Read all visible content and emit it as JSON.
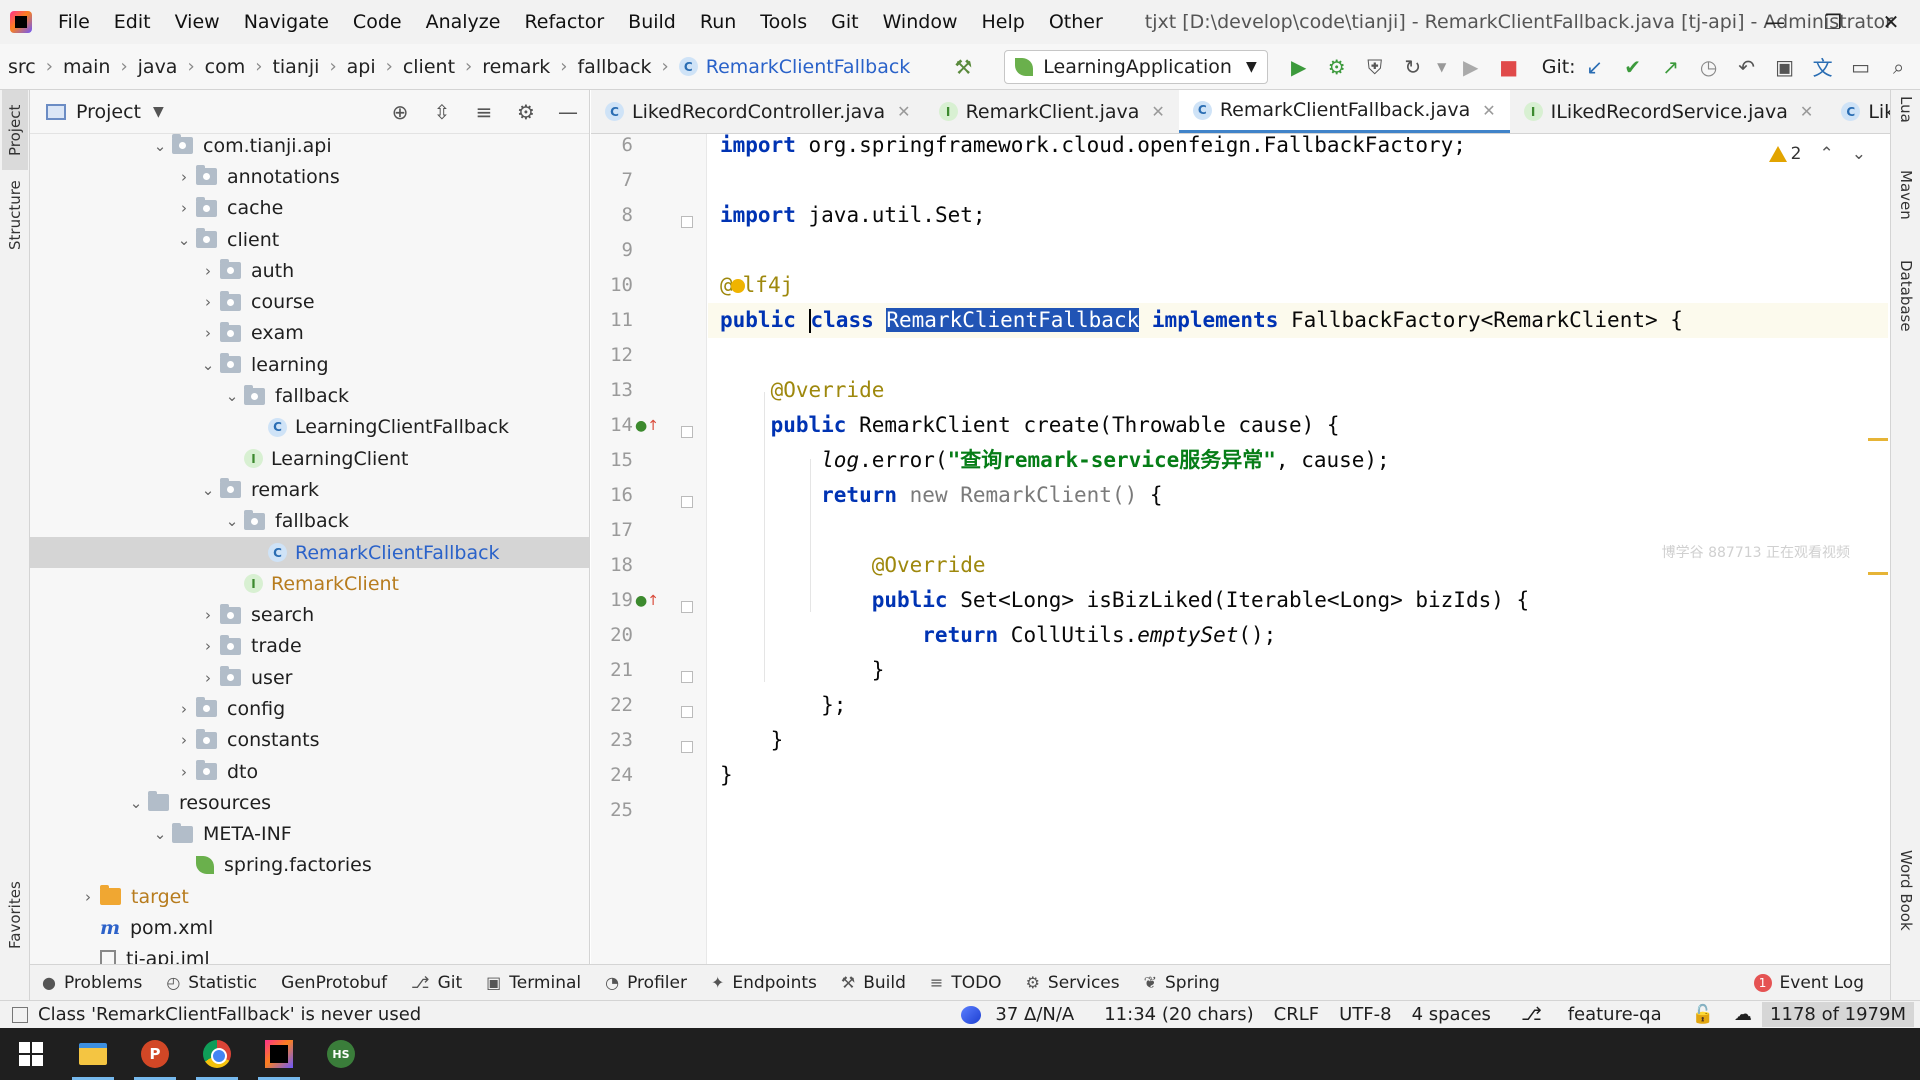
{
  "menubar": {
    "items": [
      "File",
      "Edit",
      "View",
      "Navigate",
      "Code",
      "Analyze",
      "Refactor",
      "Build",
      "Run",
      "Tools",
      "Git",
      "Window",
      "Help",
      "Other"
    ],
    "window_title": "tjxt [D:\\develop\\code\\tianji] - RemarkClientFallback.java [tj-api] - Administrator"
  },
  "breadcrumb": [
    "src",
    "main",
    "java",
    "com",
    "tianji",
    "api",
    "client",
    "remark",
    "fallback",
    "RemarkClientFallback"
  ],
  "run_config": "LearningApplication",
  "git_label": "Git:",
  "project_panel": {
    "title": "Project",
    "tree": [
      {
        "label": "com.tianji.api",
        "type": "package",
        "depth": 5,
        "state": "open"
      },
      {
        "label": "annotations",
        "type": "package",
        "depth": 6,
        "state": "closed"
      },
      {
        "label": "cache",
        "type": "package",
        "depth": 6,
        "state": "closed"
      },
      {
        "label": "client",
        "type": "package",
        "depth": 6,
        "state": "open"
      },
      {
        "label": "auth",
        "type": "package",
        "depth": 7,
        "state": "closed"
      },
      {
        "label": "course",
        "type": "package",
        "depth": 7,
        "state": "closed"
      },
      {
        "label": "exam",
        "type": "package",
        "depth": 7,
        "state": "closed"
      },
      {
        "label": "learning",
        "type": "package",
        "depth": 7,
        "state": "open"
      },
      {
        "label": "fallback",
        "type": "package",
        "depth": 8,
        "state": "open"
      },
      {
        "label": "LearningClientFallback",
        "type": "class",
        "depth": 9,
        "state": "none"
      },
      {
        "label": "LearningClient",
        "type": "interface",
        "depth": 8,
        "state": "none"
      },
      {
        "label": "remark",
        "type": "package",
        "depth": 7,
        "state": "open"
      },
      {
        "label": "fallback",
        "type": "package",
        "depth": 8,
        "state": "open"
      },
      {
        "label": "RemarkClientFallback",
        "type": "class",
        "depth": 9,
        "state": "none",
        "selected": true,
        "color": "blue"
      },
      {
        "label": "RemarkClient",
        "type": "interface",
        "depth": 8,
        "state": "none",
        "color": "orange"
      },
      {
        "label": "search",
        "type": "package",
        "depth": 7,
        "state": "closed"
      },
      {
        "label": "trade",
        "type": "package",
        "depth": 7,
        "state": "closed"
      },
      {
        "label": "user",
        "type": "package",
        "depth": 7,
        "state": "closed"
      },
      {
        "label": "config",
        "type": "package",
        "depth": 6,
        "state": "closed"
      },
      {
        "label": "constants",
        "type": "package",
        "depth": 6,
        "state": "closed"
      },
      {
        "label": "dto",
        "type": "package",
        "depth": 6,
        "state": "closed"
      },
      {
        "label": "resources",
        "type": "resources",
        "depth": 4,
        "state": "open"
      },
      {
        "label": "META-INF",
        "type": "folder",
        "depth": 5,
        "state": "open"
      },
      {
        "label": "spring.factories",
        "type": "spring",
        "depth": 6,
        "state": "none"
      },
      {
        "label": "target",
        "type": "target",
        "depth": 2,
        "state": "closed",
        "color": "orange"
      },
      {
        "label": "pom.xml",
        "type": "xml",
        "depth": 2,
        "state": "none"
      },
      {
        "label": "tj-api.iml",
        "type": "iml",
        "depth": 2,
        "state": "none"
      }
    ]
  },
  "editor_tabs": [
    {
      "label": "LikedRecordController.java",
      "type": "class",
      "active": false,
      "closable": true
    },
    {
      "label": "RemarkClient.java",
      "type": "interface",
      "active": false,
      "closable": true
    },
    {
      "label": "RemarkClientFallback.java",
      "type": "class",
      "active": true,
      "closable": true
    },
    {
      "label": "ILikedRecordService.java",
      "type": "interface",
      "active": false,
      "closable": true
    },
    {
      "label": "LikedRecordS",
      "type": "class",
      "active": false,
      "closable": false
    }
  ],
  "editor": {
    "warning_count": "2",
    "watermark": "博学谷 887713 正在观看视频",
    "line_numbers": [
      "6",
      "7",
      "8",
      "9",
      "10",
      "11",
      "12",
      "13",
      "14",
      "15",
      "16",
      "17",
      "18",
      "19",
      "20",
      "21",
      "22",
      "23",
      "24",
      "25"
    ],
    "lines": [
      [
        {
          "t": "import ",
          "c": "kw"
        },
        {
          "t": "org.springframework.cloud.openfeign.FallbackFactory;",
          "c": ""
        }
      ],
      [],
      [
        {
          "t": "import ",
          "c": "kw"
        },
        {
          "t": "java.util.Set;",
          "c": ""
        }
      ],
      [],
      [
        {
          "t": "@",
          "c": "ann"
        },
        {
          "t": "",
          "c": "bulb"
        },
        {
          "t": "lf4j",
          "c": "ann"
        }
      ],
      [
        {
          "t": "public ",
          "c": "kw"
        },
        {
          "t": "",
          "c": "cursor"
        },
        {
          "t": "class ",
          "c": "kw"
        },
        {
          "t": "RemarkClientFallback",
          "c": "sel"
        },
        {
          "t": " ",
          "c": ""
        },
        {
          "t": "implements ",
          "c": "kw"
        },
        {
          "t": "FallbackFactory<RemarkClient> {",
          "c": ""
        }
      ],
      [],
      [
        {
          "t": "    @Override",
          "c": "ann"
        }
      ],
      [
        {
          "t": "    public ",
          "c": "kw"
        },
        {
          "t": "RemarkClient create(Throwable cause) {",
          "c": ""
        }
      ],
      [
        {
          "t": "        ",
          "c": ""
        },
        {
          "t": "log",
          "c": "it"
        },
        {
          "t": ".error(",
          "c": ""
        },
        {
          "t": "\"查询remark-service服务异常\"",
          "c": "str"
        },
        {
          "t": ", cause);",
          "c": ""
        }
      ],
      [
        {
          "t": "        return ",
          "c": "kw"
        },
        {
          "t": "new ",
          "c": "gray"
        },
        {
          "t": "RemarkClient() ",
          "c": "gray"
        },
        {
          "t": "{",
          "c": ""
        }
      ],
      [],
      [
        {
          "t": "            @Override",
          "c": "ann"
        }
      ],
      [
        {
          "t": "            public ",
          "c": "kw"
        },
        {
          "t": "Set<Long> isBizLiked(Iterable<Long> bizIds) {",
          "c": ""
        }
      ],
      [
        {
          "t": "                return ",
          "c": "kw"
        },
        {
          "t": "CollUtils.",
          "c": ""
        },
        {
          "t": "emptySet",
          "c": "it"
        },
        {
          "t": "();",
          "c": ""
        }
      ],
      [
        {
          "t": "            }",
          "c": ""
        }
      ],
      [
        {
          "t": "        };",
          "c": ""
        }
      ],
      [
        {
          "t": "    }",
          "c": ""
        }
      ],
      [
        {
          "t": "}",
          "c": ""
        }
      ],
      []
    ]
  },
  "tool_windows": [
    "Problems",
    "Statistic",
    "GenProtobuf",
    "Git",
    "Terminal",
    "Profiler",
    "Endpoints",
    "Build",
    "TODO",
    "Services",
    "Spring"
  ],
  "event_log": {
    "label": "Event Log",
    "count": "1"
  },
  "left_strip": [
    "Project",
    "Structure",
    "Favorites"
  ],
  "right_strip": [
    "Lua",
    "Maven",
    "Database",
    "Word Book"
  ],
  "statusbar": {
    "message": "Class 'RemarkClientFallback' is never used",
    "delta": "37 Δ/N/A",
    "position": "11:34 (20 chars)",
    "line_sep": "CRLF",
    "encoding": "UTF-8",
    "indent": "4 spaces",
    "branch": "feature-qa",
    "memory": "1178 of 1979M"
  },
  "taskbar": [
    "start",
    "file-explorer",
    "powerpoint",
    "chrome",
    "intellij",
    "hs"
  ]
}
